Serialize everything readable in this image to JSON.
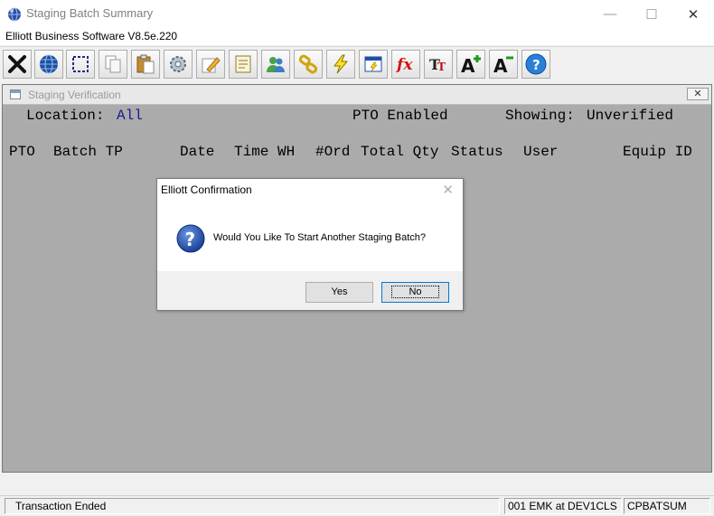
{
  "window": {
    "title": "Staging Batch Summary",
    "minimize_glyph": "—",
    "maximize_glyph": "☐",
    "close_glyph": "✕"
  },
  "menubar": {
    "text": "Elliott Business Software V8.5e.220"
  },
  "toolbar": {
    "buttons": [
      {
        "icon": "exit-icon"
      },
      {
        "icon": "globe-icon"
      },
      {
        "icon": "select-icon"
      },
      {
        "icon": "copy-icon"
      },
      {
        "icon": "paste-icon"
      },
      {
        "icon": "settings-icon"
      },
      {
        "icon": "edit-icon"
      },
      {
        "icon": "notes-icon"
      },
      {
        "icon": "users-icon"
      },
      {
        "icon": "link-icon"
      },
      {
        "icon": "lightning-icon"
      },
      {
        "icon": "report-icon"
      },
      {
        "icon": "function-icon"
      },
      {
        "icon": "font-icon"
      },
      {
        "icon": "font-increase-icon"
      },
      {
        "icon": "font-decrease-icon"
      },
      {
        "icon": "help-icon"
      }
    ]
  },
  "child_window": {
    "title": "Staging Verification",
    "close_glyph": "✕",
    "location_label": "Location:",
    "location_value": "All",
    "pto_status": "PTO Enabled",
    "showing_label": "Showing:",
    "showing_value": "Unverified",
    "columns": [
      "PTO",
      "Batch TP",
      "Date",
      "Time WH",
      "#Ord",
      "Total Qty",
      "Status",
      "User",
      "Equip ID"
    ]
  },
  "dialog": {
    "title": "Elliott Confirmation",
    "close_glyph": "✕",
    "message": "Would You Like To Start Another Staging Batch?",
    "yes_label": "Yes",
    "no_label": "No"
  },
  "statusbar": {
    "message": "Transaction Ended",
    "session": "001 EMK at DEV1CLS",
    "program": "CPBATSUM"
  },
  "colors": {
    "mdi_background": "#ababab",
    "location_value_color": "#1a1a8f",
    "help_button": "#2a7fd6"
  }
}
